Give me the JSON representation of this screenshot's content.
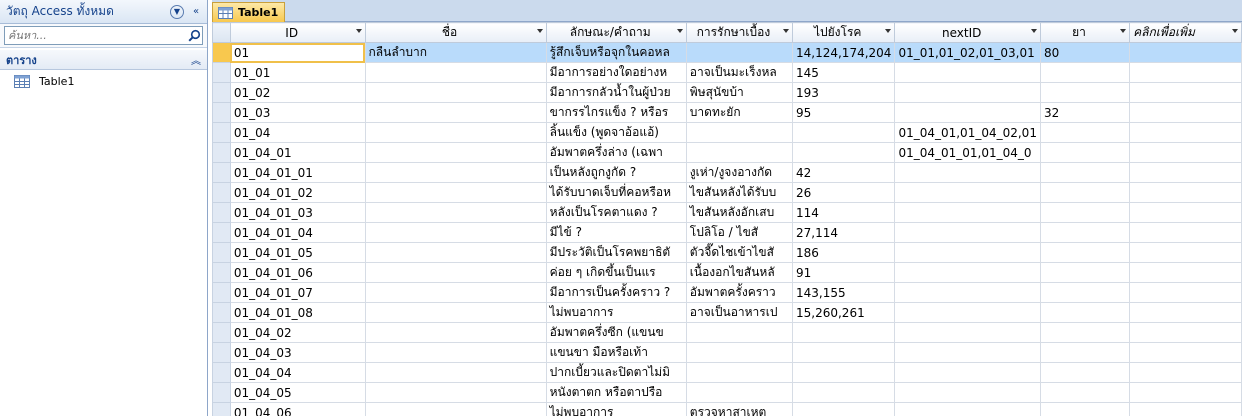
{
  "nav": {
    "title": "วัตถุ Access ทั้งหมด",
    "search_placeholder": "ค้นหา...",
    "group_label": "ตาราง",
    "items": [
      {
        "label": "Table1"
      }
    ]
  },
  "document": {
    "tab_label": "Table1"
  },
  "datasheet": {
    "columns": [
      "ID",
      "ชื่อ",
      "ลักษณะ/คำถาม",
      "การรักษาเบื้อง",
      "ไปยังโรค",
      "nextID",
      "ยา",
      "คลิกเพื่อเพิ่ม"
    ],
    "rows": [
      [
        "01",
        "กลืนลำบาก",
        "รู้สึกเจ็บหรือจุกในคอหล",
        "",
        "14,124,174,204",
        "01_01,01_02,01_03,01",
        "80",
        ""
      ],
      [
        "01_01",
        "",
        "มีอาการอย่างใดอย่างห",
        "อาจเป็นมะเร็งหล",
        "145",
        "",
        "",
        ""
      ],
      [
        "01_02",
        "",
        "มีอาการกลัวน้ำในผู้ป่วย",
        "พิษสุนัขบ้า",
        "193",
        "",
        "",
        ""
      ],
      [
        "01_03",
        "",
        "ขากรรไกรแข็ง ? หรือร",
        "บาดทะยัก",
        "95",
        "",
        "32",
        ""
      ],
      [
        "01_04",
        "",
        "ลิ้นแข็ง (พูดจาอ้อแอ้)",
        "",
        "",
        "01_04_01,01_04_02,01",
        "",
        ""
      ],
      [
        "01_04_01",
        "",
        "อัมพาตครึ่งล่าง (เฉพา",
        "",
        "",
        "01_04_01_01,01_04_0",
        "",
        ""
      ],
      [
        "01_04_01_01",
        "",
        "เป็นหลังถูกงูกัด ?",
        "งูเห่า/งูจงอางกัด",
        "42",
        "",
        "",
        ""
      ],
      [
        "01_04_01_02",
        "",
        "ได้รับบาดเจ็บที่คอหรือห",
        "ไขสันหลังได้รับบ",
        "26",
        "",
        "",
        ""
      ],
      [
        "01_04_01_03",
        "",
        "หลังเป็นโรคตาแดง ?",
        "ไขสันหลังอักเสบ",
        "114",
        "",
        "",
        ""
      ],
      [
        "01_04_01_04",
        "",
        "มีไข้ ?",
        "โปลิโอ / ไขสั",
        "27,114",
        "",
        "",
        ""
      ],
      [
        "01_04_01_05",
        "",
        "มีประวัติเป็นโรคพยาธิตั",
        "ตัวจี๊ดไชเข้าไขสั",
        "186",
        "",
        "",
        ""
      ],
      [
        "01_04_01_06",
        "",
        "ค่อย ๆ เกิดขึ้นเป็นแร",
        "เนื้องอกไขสันหลั",
        "91",
        "",
        "",
        ""
      ],
      [
        "01_04_01_07",
        "",
        "มีอาการเป็นครั้งคราว ?",
        "อัมพาตครั้งคราว",
        "143,155",
        "",
        "",
        ""
      ],
      [
        "01_04_01_08",
        "",
        "ไม่พบอาการ",
        "อาจเป็นอาหารเป",
        "15,260,261",
        "",
        "",
        ""
      ],
      [
        "01_04_02",
        "",
        "อัมพาตครึ่งซีก (แขนข",
        "",
        "",
        "",
        "",
        ""
      ],
      [
        "01_04_03",
        "",
        "แขนขา มือหรือเท้า",
        "",
        "",
        "",
        "",
        ""
      ],
      [
        "01_04_04",
        "",
        "ปากเบี้ยวและปิดตาไม่มิ",
        "",
        "",
        "",
        "",
        ""
      ],
      [
        "01_04_05",
        "",
        "หนังตาตก หรือตาปรือ",
        "",
        "",
        "",
        "",
        ""
      ],
      [
        "01_04_06",
        "",
        "ไม่พบอาการ",
        "ตรวจหาสาเหต",
        "",
        "",
        "",
        ""
      ]
    ]
  },
  "colors": {
    "tab_active": "#f8c84e",
    "current_row": "#b9dbfb",
    "nav_text": "#15428b",
    "tab_strip": "#cbdaed"
  }
}
